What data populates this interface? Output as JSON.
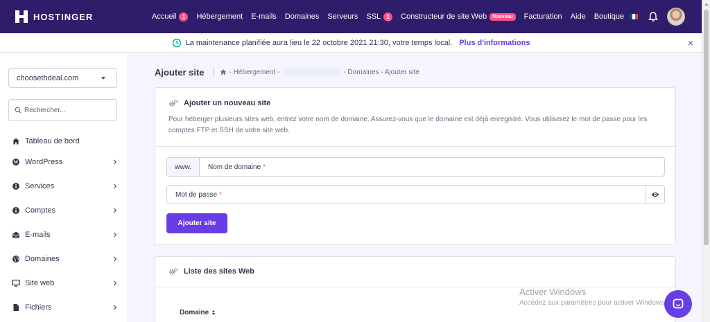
{
  "brand": {
    "name": "HOSTINGER"
  },
  "topnav": {
    "items": [
      {
        "label": "Accueil",
        "badge": "1"
      },
      {
        "label": "Hébergement"
      },
      {
        "label": "E-mails"
      },
      {
        "label": "Domaines"
      },
      {
        "label": "Serveurs"
      },
      {
        "label": "SSL",
        "badge": "1"
      },
      {
        "label": "Constructeur de site Web",
        "badge": "Nouveau"
      },
      {
        "label": "Facturation"
      },
      {
        "label": "Aide"
      },
      {
        "label": "Boutique"
      }
    ],
    "flag_colors": [
      "#0055a4",
      "#ffffff",
      "#ef4135"
    ]
  },
  "banner": {
    "text": "La maintenance planifiée aura lieu le 22 octobre 2021 21:30, votre temps local.",
    "link": "Plus d'informations",
    "close": "×"
  },
  "sidebar": {
    "domain": "choosethdeal.com",
    "search_placeholder": "Rechercher...",
    "items": [
      {
        "label": "Tableau de bord",
        "icon": "home-icon"
      },
      {
        "label": "WordPress",
        "icon": "wordpress-icon"
      },
      {
        "label": "Services",
        "icon": "info-icon"
      },
      {
        "label": "Comptes",
        "icon": "info-icon"
      },
      {
        "label": "E-mails",
        "icon": "envelope-icon"
      },
      {
        "label": "Domaines",
        "icon": "globe-icon"
      },
      {
        "label": "Site web",
        "icon": "monitor-icon"
      },
      {
        "label": "Fichiers",
        "icon": "file-icon"
      }
    ]
  },
  "page": {
    "title": "Ajouter site",
    "breadcrumb": {
      "part1": "- Hébergement -",
      "part2": "- Domaines - Ajouter site"
    }
  },
  "add_site": {
    "title": "Ajouter un nouveau site",
    "description": "Pour héberger plusieurs sites web, entrez votre nom de domaine. Assurez-vous que le domaine est déjà enregistré. Vous utiliserez le mot de passe pour les comptes FTP et SSH de votre site web.",
    "prefix": "www.",
    "domain_placeholder": "Nom de domaine",
    "password_placeholder": "Mot de passe",
    "required_mark": "*",
    "submit": "Ajouter site"
  },
  "sites_list": {
    "title": "Liste des sites Web",
    "column": "Domaine"
  },
  "watermark": {
    "line1": "Activer Windows",
    "line2": "Accédez aux paramètres pour activer Windows."
  },
  "colors": {
    "nav_bg": "#2f1c6a",
    "accent": "#673de6",
    "badge": "#fc5185",
    "page_bg": "#f4f5ff"
  }
}
